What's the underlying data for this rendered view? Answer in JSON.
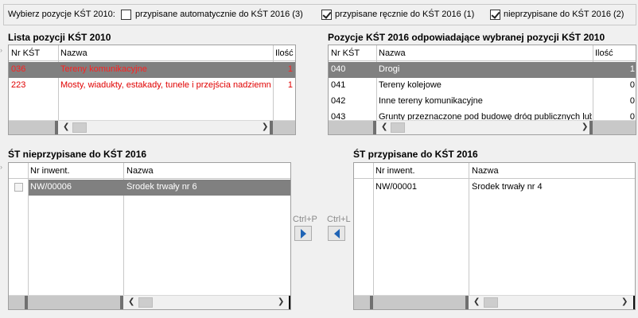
{
  "filter": {
    "label": "Wybierz pozycje KŚT 2010:",
    "options": [
      {
        "label": "przypisane automatycznie do KŚT 2016 (3)",
        "checked": false
      },
      {
        "label": "przypisane ręcznie do KŚT 2016 (1)",
        "checked": true
      },
      {
        "label": "nieprzypisane do KŚT 2016 (2)",
        "checked": true
      }
    ]
  },
  "kst2010": {
    "title": "Lista pozycji KŚT 2010",
    "headers": [
      "Nr KŚT",
      "Nazwa",
      "Ilość"
    ],
    "rows": [
      {
        "nr": "036",
        "nazwa": "Tereny komunikacyjne",
        "ilosc": "1"
      },
      {
        "nr": "223",
        "nazwa": "Mosty, wiadukty, estakady, tunele i przejścia nadziemne",
        "ilosc": "1"
      }
    ]
  },
  "kst2016": {
    "title": "Pozycje KŚT 2016 odpowiadające wybranej pozycji KŚT 2010",
    "headers": [
      "Nr KŚT",
      "Nazwa",
      "Ilość"
    ],
    "rows": [
      {
        "nr": "040",
        "nazwa": "Drogi",
        "ilosc": "1"
      },
      {
        "nr": "041",
        "nazwa": "Tereny kolejowe",
        "ilosc": "0"
      },
      {
        "nr": "042",
        "nazwa": "Inne tereny komunikacyjne",
        "ilosc": "0"
      },
      {
        "nr": "043",
        "nazwa": "Grunty przeznaczone pod budowę dróg publicznych lub l",
        "ilosc": "0"
      }
    ]
  },
  "unassigned": {
    "title": "ŚT nieprzypisane do KŚT 2016",
    "headers": [
      "Nr inwent.",
      "Nazwa"
    ],
    "rows": [
      {
        "nr": "NW/00006",
        "nazwa": "Środek trwały nr 6"
      }
    ]
  },
  "assigned": {
    "title": "ŚT przypisane do KŚT 2016",
    "headers": [
      "Nr inwent.",
      "Nazwa"
    ],
    "rows": [
      {
        "nr": "NW/00001",
        "nazwa": "Środek trwały nr 4"
      }
    ]
  },
  "actions": {
    "assign_shortcut": "Ctrl+P",
    "unassign_shortcut": "Ctrl+L"
  },
  "icons": {
    "assign": "arrow-right-icon",
    "unassign": "arrow-left-icon",
    "scroll_left": "scroll-left-icon",
    "scroll_right": "scroll-right-icon"
  },
  "colors": {
    "selected_row": "#808080",
    "red_text": "#e00000",
    "arrow_blue": "#1e63b5"
  }
}
